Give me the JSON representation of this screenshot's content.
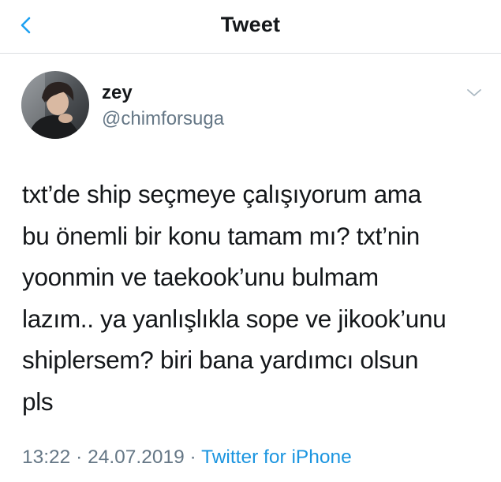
{
  "header": {
    "back_icon": "chevron-left-icon",
    "title": "Tweet"
  },
  "tweet": {
    "author": {
      "name": "zey",
      "handle": "@chimforsuga",
      "avatar_icon": "profile-photo"
    },
    "menu_icon": "chevron-down-icon",
    "text_lines": [
      "txt’de ship seçmeye çalışıyorum ama",
      "bu önemli bir konu tamam mı? txt’nin",
      "yoonmin ve taekook’unu bulmam",
      "lazım.. ya yanlışlıkla sope ve jikook’unu",
      "shiplersem? biri bana yardımcı olsun",
      "pls"
    ],
    "time": "13:22",
    "separator": "·",
    "date": "24.07.2019",
    "source": "Twitter for iPhone"
  },
  "colors": {
    "accent": "#1b95e0",
    "text_primary": "#14171a",
    "text_secondary": "#657786",
    "divider": "#dcdfe2"
  }
}
